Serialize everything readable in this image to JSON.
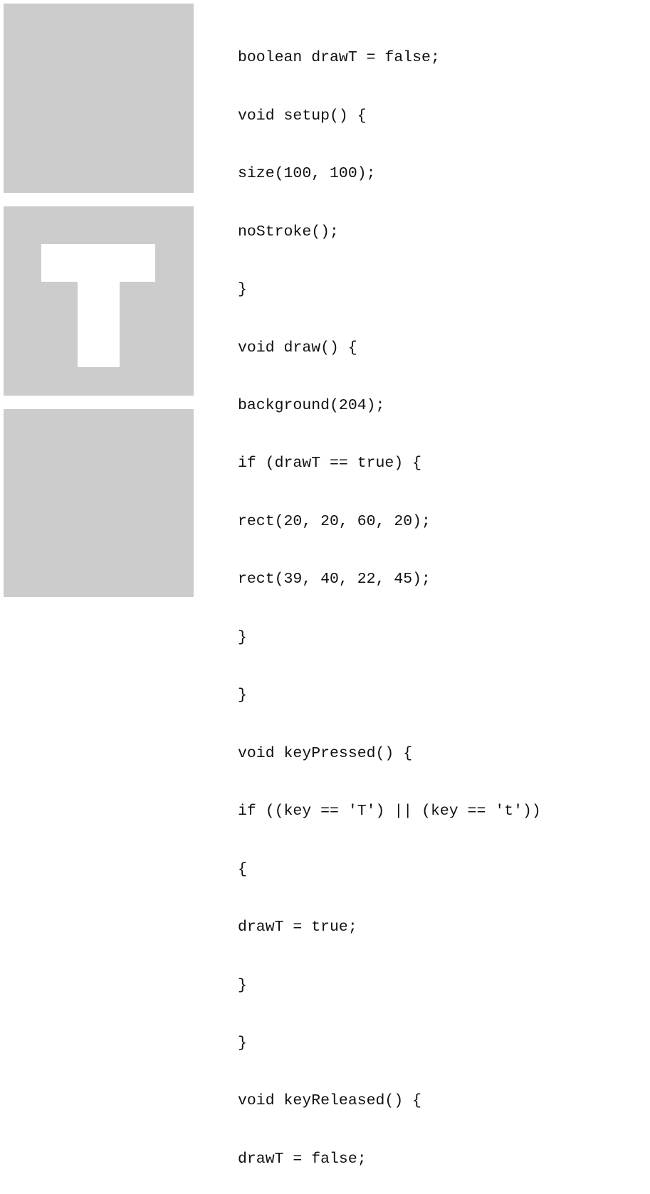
{
  "sketch_frames": [
    {
      "state": "not pressed",
      "shows_t": false
    },
    {
      "state": "T pressed",
      "shows_t": true
    },
    {
      "state": "released",
      "shows_t": false
    }
  ],
  "colors": {
    "canvas_background": "#cccccc",
    "shape_fill": "#ffffff",
    "code_text": "#111111"
  },
  "code": {
    "lines": [
      "boolean drawT = false;",
      "void setup() {",
      "size(100, 100);",
      "noStroke();",
      "}",
      "void draw() {",
      "background(204);",
      "if (drawT == true) {",
      "rect(20, 20, 60, 20);",
      "rect(39, 40, 22, 45);",
      "}",
      "}",
      "void keyPressed() {",
      "if ((key == 'T') || (key == 't'))",
      "{",
      "drawT = true;",
      "}",
      "}",
      "void keyReleased() {",
      "drawT = false;",
      "}"
    ]
  }
}
